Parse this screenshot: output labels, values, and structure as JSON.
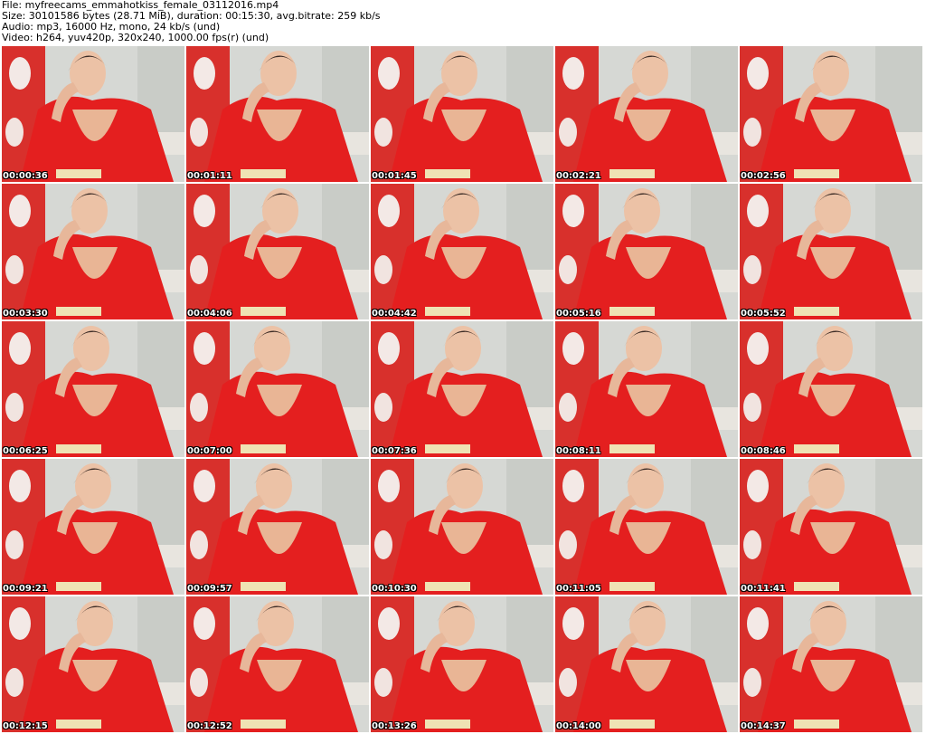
{
  "header": {
    "file_line": "File: myfreecams_emmahotkiss_female_03112016.mp4",
    "size_line": "Size: 30101586 bytes (28.71 MiB), duration: 00:15:30, avg.bitrate: 259 kb/s",
    "audio_line": "Audio: mp3, 16000 Hz, mono, 24 kb/s (und)",
    "video_line": "Video: h264, yuv420p, 320x240, 1000.00 fps(r) (und)"
  },
  "thumbnails": [
    {
      "timestamp": "00:00:36"
    },
    {
      "timestamp": "00:01:11"
    },
    {
      "timestamp": "00:01:45"
    },
    {
      "timestamp": "00:02:21"
    },
    {
      "timestamp": "00:02:56"
    },
    {
      "timestamp": "00:03:30"
    },
    {
      "timestamp": "00:04:06"
    },
    {
      "timestamp": "00:04:42"
    },
    {
      "timestamp": "00:05:16"
    },
    {
      "timestamp": "00:05:52"
    },
    {
      "timestamp": "00:06:25"
    },
    {
      "timestamp": "00:07:00"
    },
    {
      "timestamp": "00:07:36"
    },
    {
      "timestamp": "00:08:11"
    },
    {
      "timestamp": "00:08:46"
    },
    {
      "timestamp": "00:09:21"
    },
    {
      "timestamp": "00:09:57"
    },
    {
      "timestamp": "00:10:30"
    },
    {
      "timestamp": "00:11:05"
    },
    {
      "timestamp": "00:11:41"
    },
    {
      "timestamp": "00:12:15"
    },
    {
      "timestamp": "00:12:52"
    },
    {
      "timestamp": "00:13:26"
    },
    {
      "timestamp": "00:14:00"
    },
    {
      "timestamp": "00:14:37"
    }
  ]
}
